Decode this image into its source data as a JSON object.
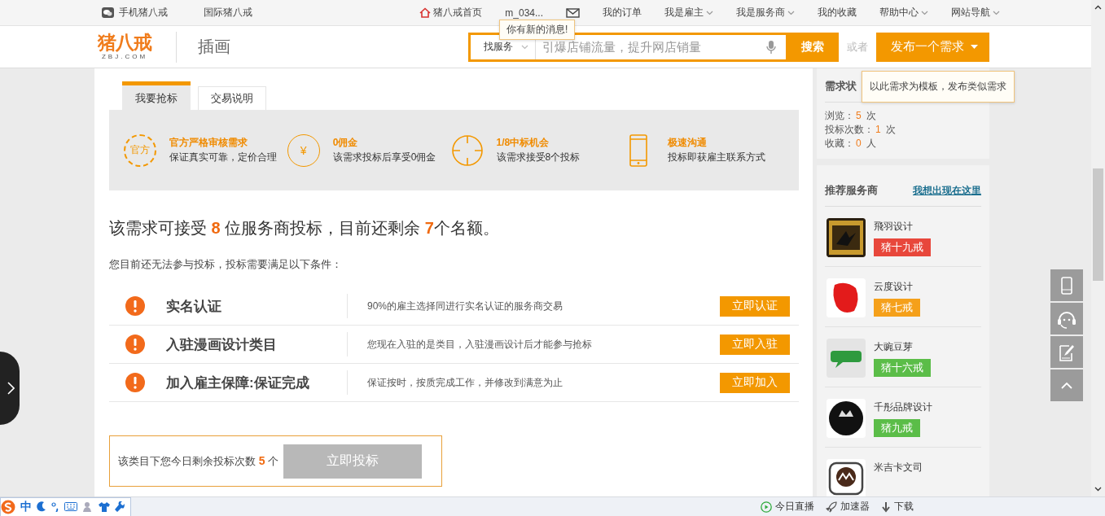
{
  "top_bar": {
    "left_links": [
      {
        "label": "手机猪八戒",
        "kind": "app"
      },
      {
        "label": "国际猪八戒",
        "kind": "plain"
      }
    ],
    "right_links": [
      {
        "label": "猪八戒首页",
        "kind": "home"
      },
      {
        "label": "m_034...",
        "kind": "plain"
      },
      {
        "kind": "mail"
      },
      {
        "label": "我的订单",
        "kind": "plain"
      },
      {
        "label": "我是雇主",
        "kind": "dropdown"
      },
      {
        "label": "我是服务商",
        "kind": "dropdown"
      },
      {
        "label": "我的收藏",
        "kind": "plain"
      },
      {
        "label": "帮助中心",
        "kind": "dropdown"
      },
      {
        "label": "网站导航",
        "kind": "dropdown"
      }
    ],
    "message_tooltip": "你有新的消息!"
  },
  "header": {
    "logo": {
      "name": "猪八戒",
      "domain": "ZBJ.COM"
    },
    "category": "插画",
    "search": {
      "scope": "找服务",
      "placeholder": "引爆店铺流量，提升网店销量",
      "button": "搜索"
    },
    "or_text": "或者",
    "publish_button": "发布一个需求",
    "publish_tooltip": "以此需求为模板，发布类似需求"
  },
  "tabs": [
    {
      "label": "我要抢标",
      "selected": true
    },
    {
      "label": "交易说明",
      "selected": false
    }
  ],
  "features": [
    {
      "kind": "badge",
      "icon_text": "官方",
      "title": "官方严格审核需求",
      "desc": "保证真实可靠，定价合理"
    },
    {
      "kind": "coin",
      "icon_text": "¥",
      "title": "0佣金",
      "desc": "该需求投标后享受0佣金"
    },
    {
      "kind": "target",
      "title": "1/8中标机会",
      "desc": "该需求接受8个投标"
    },
    {
      "kind": "phone",
      "title": "极速沟通",
      "desc": "投标即获雇主联系方式"
    }
  ],
  "headline": "该需求可接受 **8** 位服务商投标，目前还剩余 **7**个名额。",
  "requirement_note": "您目前还无法参与投标，投标需要满足以下条件：",
  "conditions": [
    {
      "title": "实名认证",
      "desc": "90%的雇主选择同进行实名认证的服务商交易",
      "button": "立即认证"
    },
    {
      "title": "入驻漫画设计类目",
      "desc": "您现在入驻的是类目，入驻漫画设计后才能参与抢标",
      "button": "立即入驻"
    },
    {
      "title": "加入雇主保障:保证完成",
      "desc": "保证按时，按质完成工作，并修改到满意为止",
      "button": "立即加入"
    }
  ],
  "bid_box": {
    "text": "该类目下您今日剩余投标次数 **5** 个",
    "button": "立即投标",
    "disabled": true
  },
  "sidebar": {
    "status_title": "需求状",
    "stats": [
      {
        "label": "浏览：",
        "value": "5",
        "unit": "次"
      },
      {
        "label": "投标次数：",
        "value": "1",
        "unit": "次"
      },
      {
        "label": "收藏：",
        "value": "0",
        "unit": "人"
      }
    ],
    "providers_title": "推荐服务商",
    "providers_link": "我想出现在这里",
    "providers": [
      {
        "name": "飛羽设计",
        "badge": "猪十九戒",
        "color": "#e8473b"
      },
      {
        "name": "云度设计",
        "badge": "猪七戒",
        "color": "#f5a01a"
      },
      {
        "name": "大豌豆芽",
        "badge": "猪十六戒",
        "color": "#5bbd48"
      },
      {
        "name": "千彤品牌设计",
        "badge": "猪九戒",
        "color": "#5bbd48"
      },
      {
        "name": "米吉卡文司"
      }
    ]
  },
  "float_tools": [
    {
      "kind": "phone"
    },
    {
      "kind": "headset"
    },
    {
      "kind": "edit"
    },
    {
      "kind": "top"
    }
  ],
  "status_bar": {
    "ime": "中",
    "items": [
      {
        "kind": "live",
        "label": "今日直播"
      },
      {
        "kind": "speed",
        "label": "加速器"
      },
      {
        "kind": "download",
        "label": "下载"
      }
    ]
  }
}
